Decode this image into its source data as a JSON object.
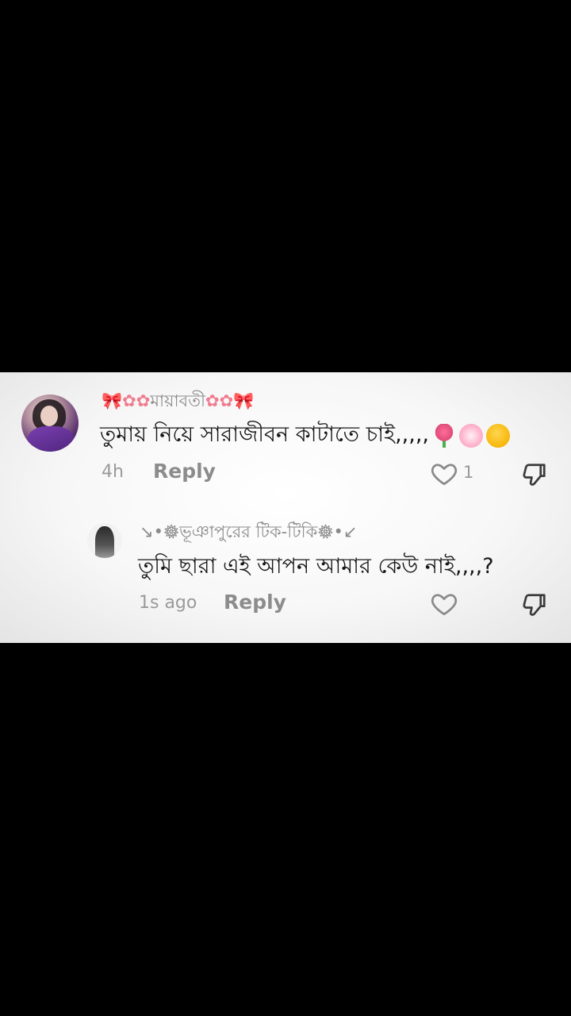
{
  "comments": [
    {
      "username_prefix": "🎀✿✿",
      "username_core": "মায়াবতী",
      "username_suffix": "✿✿🎀",
      "text": "তুমায় নিয়ে সারাজীবন কাটাতে চাই,,,,,",
      "emojis": [
        "tulip-emoji",
        "cherry-blossom-emoji",
        "melting-face-emoji"
      ],
      "time": "4h",
      "reply_label": "Reply",
      "like_count": "1",
      "accent_color": "#f07c8f"
    },
    {
      "username": "↘︎•𖣔ভূঞাপুরের টিক-টিকি𖣔•↙︎",
      "text": "তুমি ছারা এই আপন আমার কেউ নাই,,,,?",
      "time": "1s ago",
      "reply_label": "Reply"
    }
  ],
  "colors": {
    "panel_bg": "#f7f7f7",
    "text": "#161616",
    "muted": "#9a9a9a",
    "background": "#000000"
  }
}
